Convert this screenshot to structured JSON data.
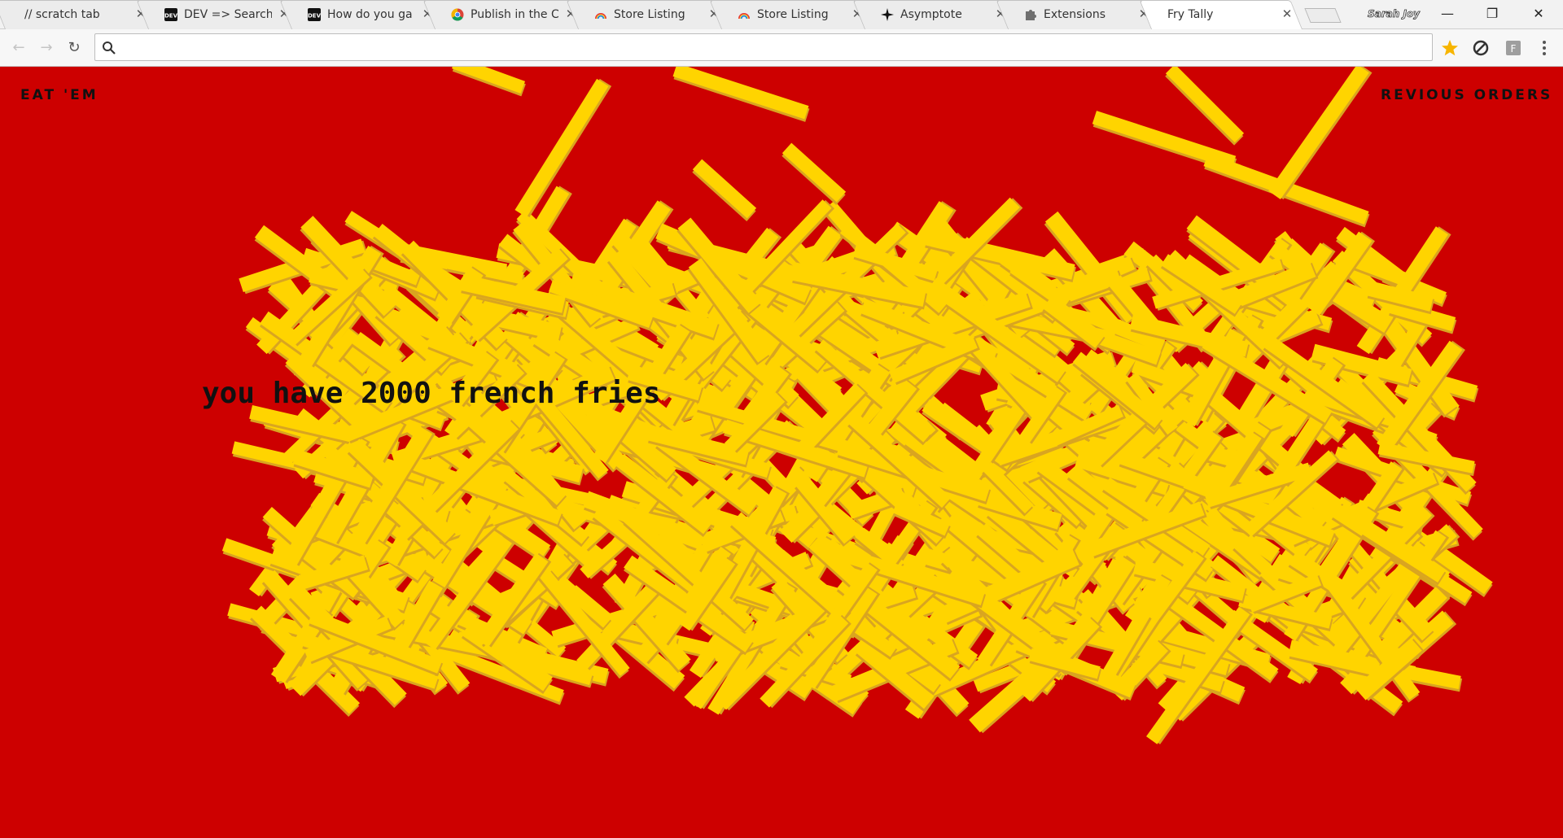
{
  "browser": {
    "tabs": [
      {
        "title": "// scratch tab",
        "icon": "none"
      },
      {
        "title": "DEV => Search",
        "icon": "dev-logo-icon"
      },
      {
        "title": "How do you ga",
        "icon": "dev-logo-icon"
      },
      {
        "title": "Publish in the C",
        "icon": "chrome-logo-icon"
      },
      {
        "title": "Store Listing",
        "icon": "rainbow-icon"
      },
      {
        "title": "Store Listing",
        "icon": "rainbow-icon"
      },
      {
        "title": "Asymptote",
        "icon": "sparkle-icon"
      },
      {
        "title": "Extensions",
        "icon": "puzzle-piece-icon"
      },
      {
        "title": "Fry Tally",
        "icon": "none",
        "active": true
      }
    ],
    "tab_close_glyph": "✕",
    "profile_name": "Sarah Joy",
    "address_value": "",
    "colors": {
      "tabstrip": "#f2f2f2",
      "toolbar": "#f7f7f7",
      "bookmark_star": "#f7b500"
    }
  },
  "page": {
    "nav_left": "EAT 'EM",
    "nav_right": "REVIOUS ORDERS",
    "tally_text": "you have 2000 french fries",
    "colors": {
      "background": "#cd0000",
      "fry": "#ffd400",
      "fry_shadow": "#d9a520",
      "text": "#111111"
    }
  }
}
